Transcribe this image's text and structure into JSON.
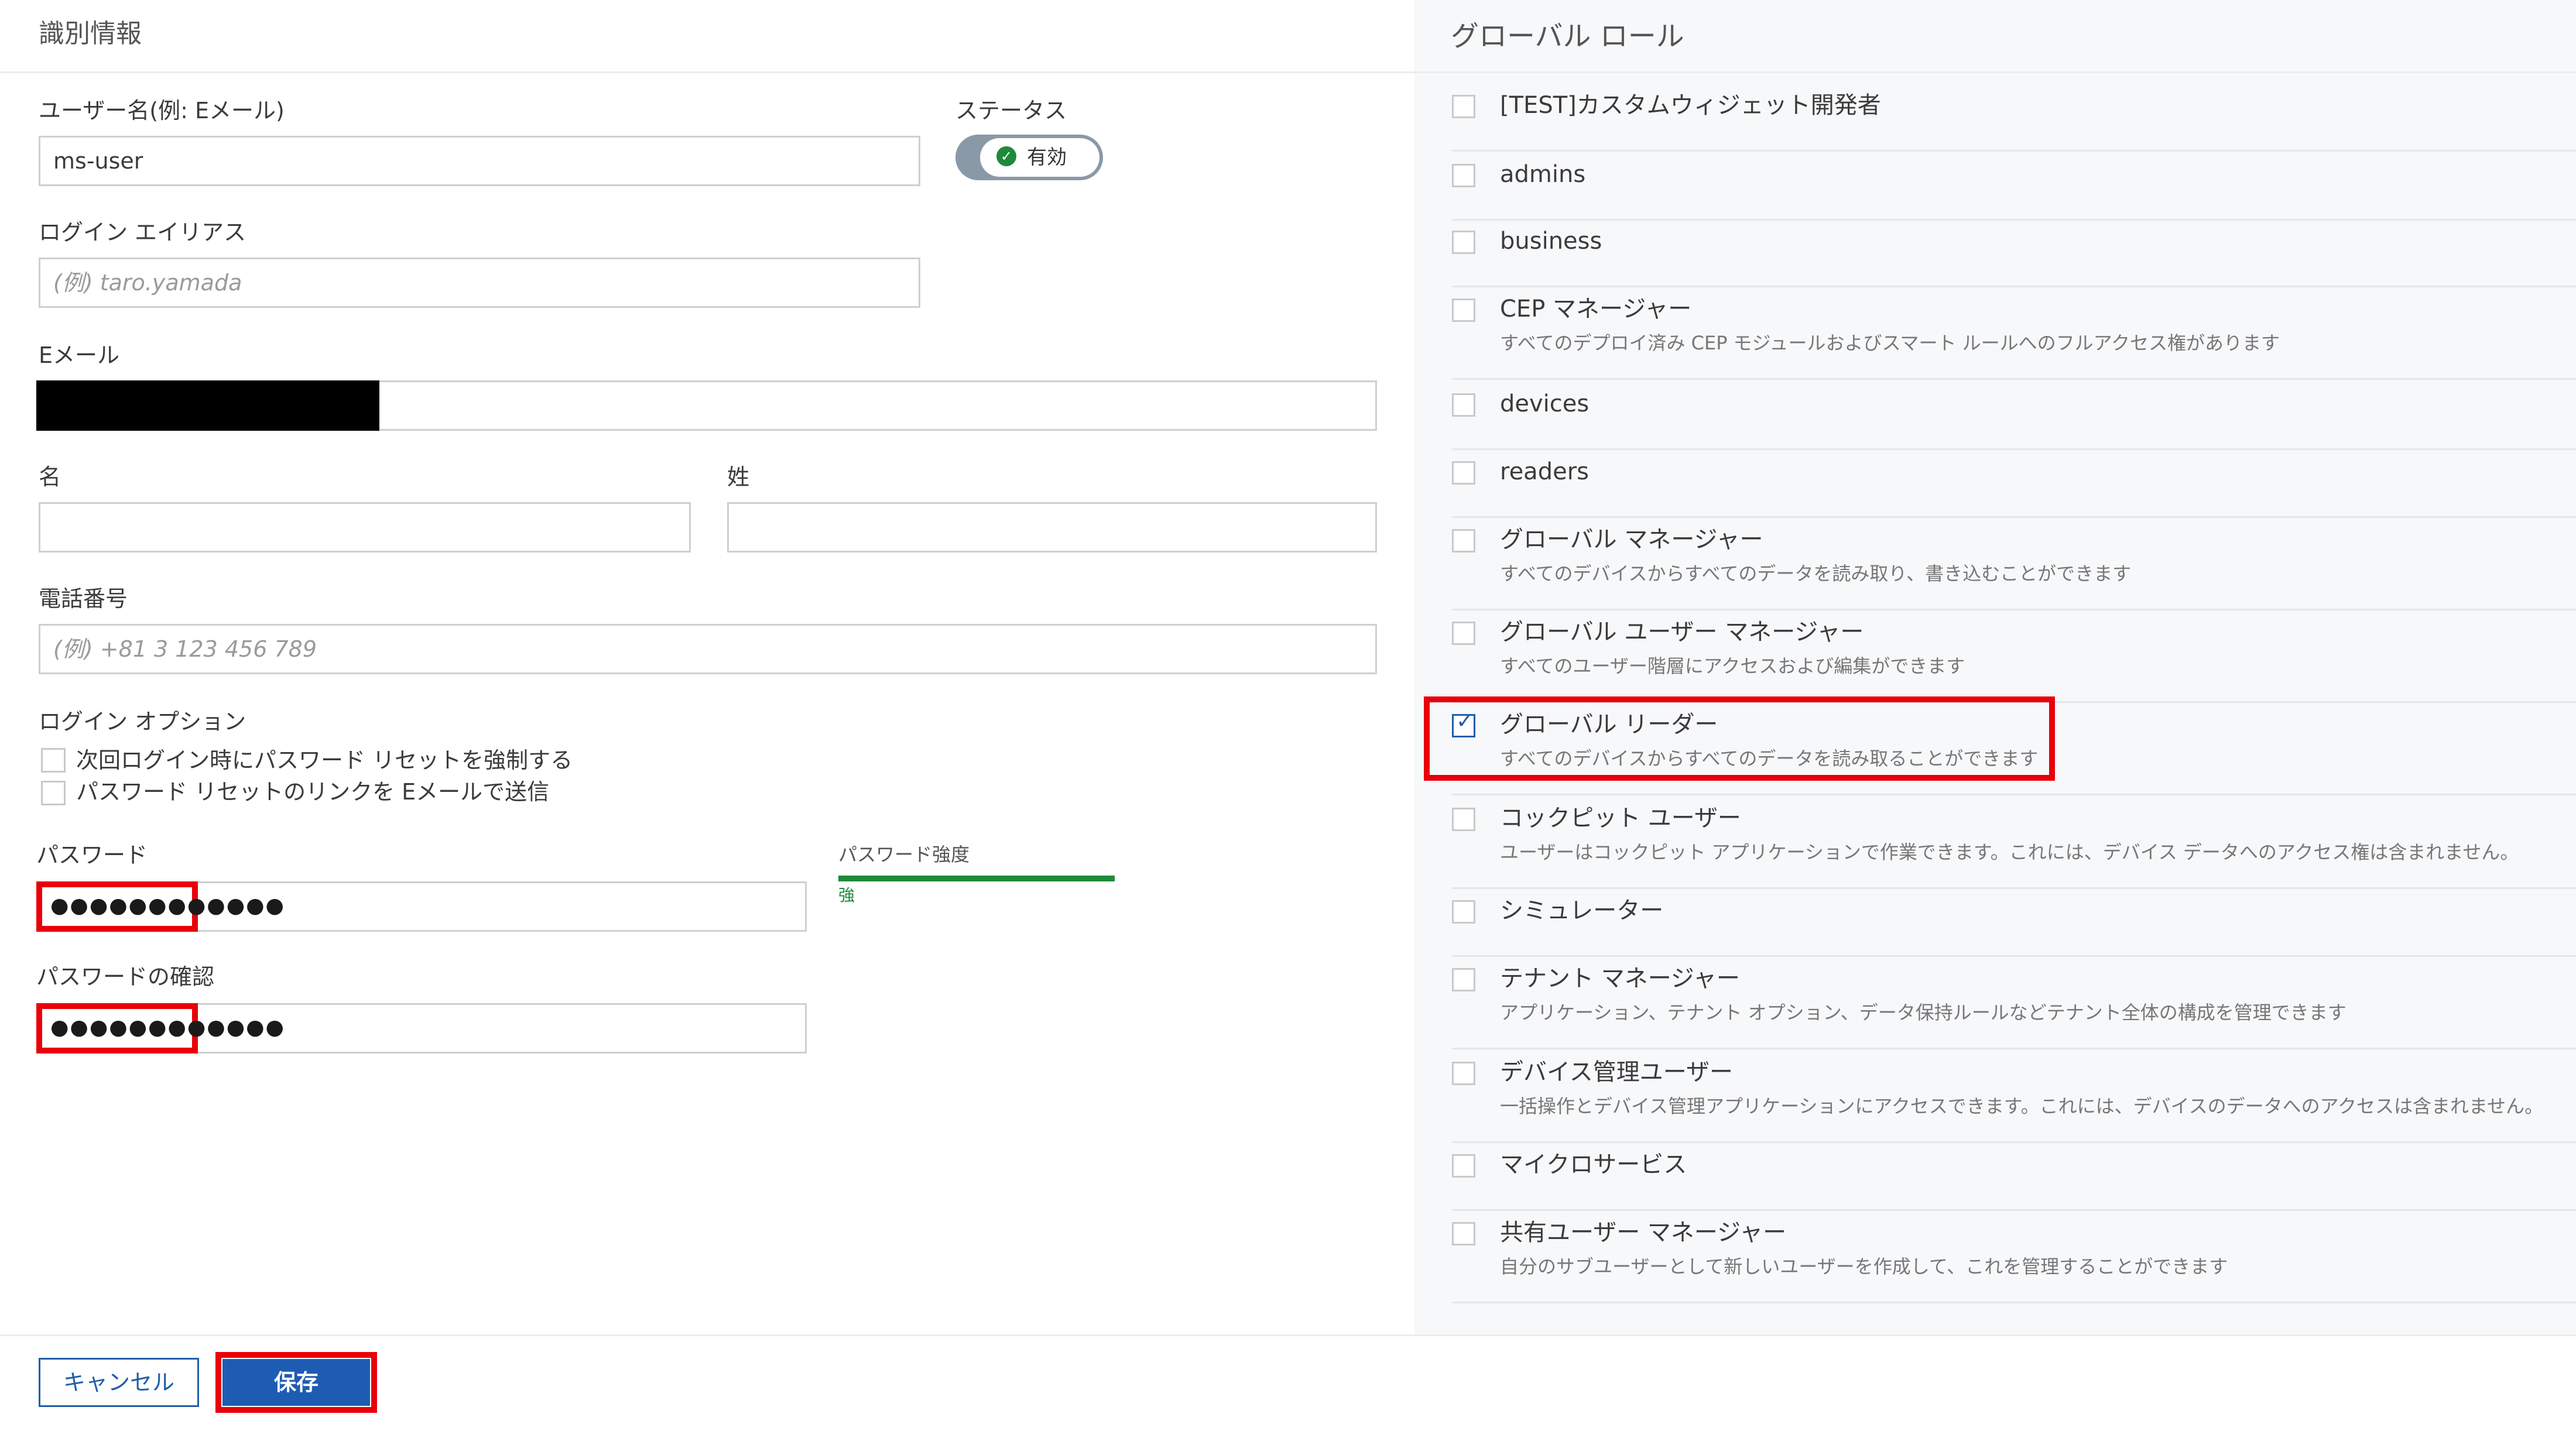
{
  "identity": {
    "section_title": "識別情報",
    "username_label": "ユーザー名(例: Eメール)",
    "username_value": "ms-user",
    "status_label": "ステータス",
    "status_value": "有効",
    "login_alias_label": "ログイン エイリアス",
    "login_alias_placeholder": "(例) taro.yamada",
    "email_label": "Eメール",
    "first_name_label": "名",
    "last_name_label": "姓",
    "phone_label": "電話番号",
    "phone_placeholder": "(例) +81 3 123 456 789",
    "login_options_label": "ログイン オプション",
    "option_force_reset": "次回ログイン時にパスワード リセットを強制する",
    "option_send_reset_link": "パスワード リセットのリンクを Eメールで送信",
    "password_label": "パスワード",
    "password_mask": "●●●●●●●●●●●●",
    "password_strength_label": "パスワード強度",
    "password_strength_value": "強",
    "password_confirm_label": "パスワードの確認",
    "password_confirm_mask": "●●●●●●●●●●●●"
  },
  "roles": {
    "title": "グローバル ロール",
    "items": [
      {
        "name": "[TEST]カスタムウィジェット開発者",
        "desc": "",
        "checked": false
      },
      {
        "name": "admins",
        "desc": "",
        "checked": false
      },
      {
        "name": "business",
        "desc": "",
        "checked": false
      },
      {
        "name": "CEP マネージャー",
        "desc": "すべてのデプロイ済み CEP モジュールおよびスマート ルールへのフルアクセス権があります",
        "checked": false
      },
      {
        "name": "devices",
        "desc": "",
        "checked": false
      },
      {
        "name": "readers",
        "desc": "",
        "checked": false
      },
      {
        "name": "グローバル マネージャー",
        "desc": "すべてのデバイスからすべてのデータを読み取り、書き込むことができます",
        "checked": false
      },
      {
        "name": "グローバル ユーザー マネージャー",
        "desc": "すべてのユーザー階層にアクセスおよび編集ができます",
        "checked": false
      },
      {
        "name": "グローバル リーダー",
        "desc": "すべてのデバイスからすべてのデータを読み取ることができます",
        "checked": true
      },
      {
        "name": "コックピット ユーザー",
        "desc": "ユーザーはコックピット アプリケーションで作業できます。これには、デバイス データへのアクセス権は含まれません。",
        "checked": false
      },
      {
        "name": "シミュレーター",
        "desc": "",
        "checked": false
      },
      {
        "name": "テナント マネージャー",
        "desc": "アプリケーション、テナント オプション、データ保持ルールなどテナント全体の構成を管理できます",
        "checked": false
      },
      {
        "name": "デバイス管理ユーザー",
        "desc": "一括操作とデバイス管理アプリケーションにアクセスできます。これには、デバイスのデータへのアクセスは含まれません。",
        "checked": false
      },
      {
        "name": "マイクロサービス",
        "desc": "",
        "checked": false
      },
      {
        "name": "共有ユーザー マネージャー",
        "desc": "自分のサブユーザーとして新しいユーザーを作成して、これを管理することができます",
        "checked": false
      }
    ]
  },
  "footer": {
    "cancel_label": "キャンセル",
    "save_label": "保存"
  },
  "colors": {
    "primary": "#1e5cb3",
    "highlight": "#e8000a",
    "strength_bar": "#1e8a3a",
    "status_ok": "#1e8a3a"
  }
}
